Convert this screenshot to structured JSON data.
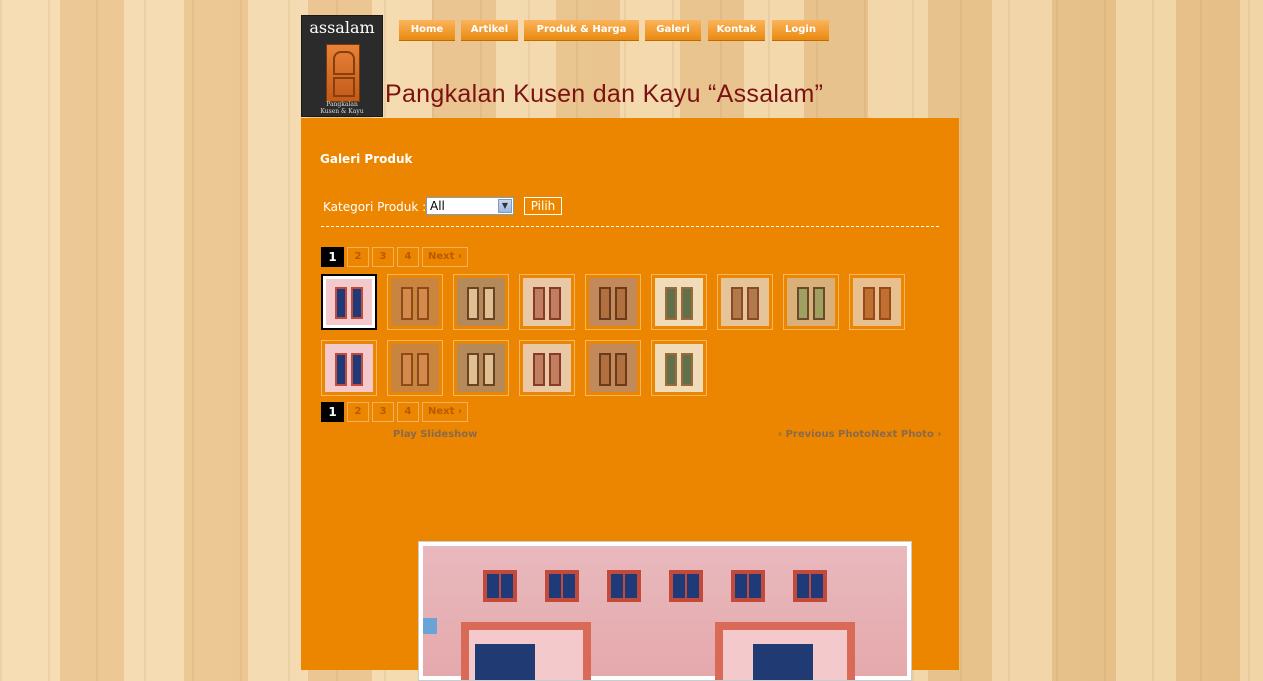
{
  "logo": {
    "title": "assalam",
    "subtitle_line1": "Pangkalan",
    "subtitle_line2": "Kusen & Kayu"
  },
  "nav": {
    "items": [
      "Home",
      "Artikel",
      "Produk & Harga",
      "Galeri",
      "Kontak",
      "Login"
    ]
  },
  "site_title": "Pangkalan Kusen dan Kayu “Assalam”",
  "gallery": {
    "title": "Galeri Produk",
    "category_label": "Kategori Produk :",
    "category_selected": "All",
    "submit_label": "Pilih",
    "pagination": {
      "pages": [
        "1",
        "2",
        "3",
        "4"
      ],
      "current": "1",
      "next_label": "Next ›"
    },
    "thumbnail_count": 15,
    "selected_thumbnail": 1,
    "play_slideshow": "Play Slideshow",
    "previous_photo": "‹ Previous Photo",
    "next_photo": "Next Photo ›"
  },
  "colors": {
    "accent": "#ec8600",
    "title_text": "#7a1212",
    "nav_button": "#f29d2a",
    "active_page": "#000000"
  }
}
